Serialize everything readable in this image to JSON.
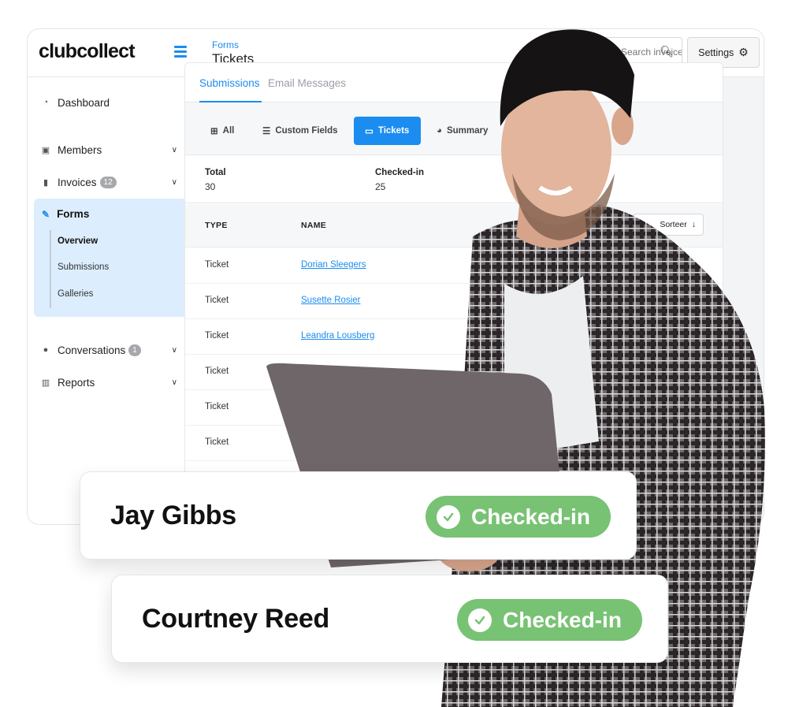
{
  "app": {
    "logo": "clubcollect",
    "breadcrumb": "Forms",
    "page_title": "Tickets",
    "search_placeholder": "Search invoices",
    "settings_label": "Settings"
  },
  "sidebar": {
    "items": [
      {
        "label": "Dashboard",
        "icon": "dashboard-icon",
        "badge": null,
        "chevron": false
      },
      {
        "label": "Members",
        "icon": "members-icon",
        "badge": null,
        "chevron": true
      },
      {
        "label": "Invoices",
        "icon": "invoice-icon",
        "badge": "12",
        "chevron": true
      },
      {
        "label": "Forms",
        "icon": "pencil-icon",
        "badge": null,
        "chevron": false,
        "active": true,
        "subitems": [
          {
            "label": "Overview",
            "active": true
          },
          {
            "label": "Submissions",
            "active": false
          },
          {
            "label": "Galleries",
            "active": false
          }
        ]
      },
      {
        "label": "Conversations",
        "icon": "chat-icon",
        "badge": "1",
        "chevron": true
      },
      {
        "label": "Reports",
        "icon": "book-icon",
        "badge": null,
        "chevron": true
      }
    ]
  },
  "main": {
    "tabs": [
      {
        "label": "Submissions",
        "active": true
      },
      {
        "label": "Email Messages",
        "active": false
      }
    ],
    "filters": [
      {
        "label": "All",
        "icon": "grid-icon",
        "active": false
      },
      {
        "label": "Custom Fields",
        "icon": "list-icon",
        "active": false
      },
      {
        "label": "Tickets",
        "icon": "ticket-icon",
        "active": true
      },
      {
        "label": "Summary",
        "icon": "pie-chart-icon",
        "active": false
      }
    ],
    "stats": [
      {
        "label": "Total",
        "value": "30"
      },
      {
        "label": "Checked-in",
        "value": "25"
      }
    ],
    "table": {
      "columns": [
        "TYPE",
        "NAME"
      ],
      "sort_label": "Sorteer",
      "rows": [
        {
          "type": "Ticket",
          "name": "Dorian Sleegers"
        },
        {
          "type": "Ticket",
          "name": "Susette Rosier"
        },
        {
          "type": "Ticket",
          "name": "Leandra Lousberg"
        },
        {
          "type": "Ticket",
          "name": ""
        },
        {
          "type": "Ticket",
          "name": ""
        },
        {
          "type": "Ticket",
          "name": ""
        }
      ]
    }
  },
  "checkins": [
    {
      "name": "Jay Gibbs",
      "status": "Checked-in"
    },
    {
      "name": "Courtney Reed",
      "status": "Checked-in"
    }
  ],
  "colors": {
    "accent": "#1b8cf0",
    "checked_in": "#78c274",
    "forms_active_bg": "#dcedfd"
  }
}
